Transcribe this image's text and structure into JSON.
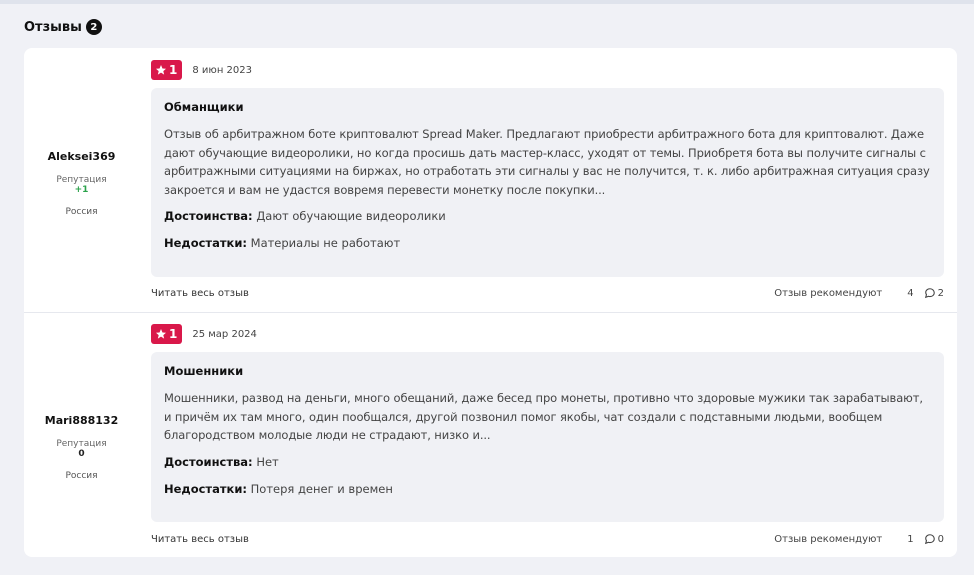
{
  "section": {
    "title": "Отзывы",
    "count": "2"
  },
  "reviews": [
    {
      "author": "Aleksei369",
      "reputation_label": "Репутация",
      "reputation_value": "+1",
      "country": "Россия",
      "rating": "1",
      "date": "8 июн 2023",
      "title": "Обманщики",
      "text": "Отзыв об арбитражном боте криптовалют Spread Maker. Предлагают приобрести арбитражного бота для криптовалют. Даже дают обучающие видеоролики, но когда просишь дать мастер-класс, уходят от темы. Приобретя бота вы получите сигналы с арбитражными ситуациями на биржах, но отработать эти сигналы у вас не получится, т. к. либо арбитражная ситуация сразу закроется и вам не удастся вовремя перевести монетку после покупки...",
      "pros_label": "Достоинства:",
      "pros": "Дают обучающие видеоролики",
      "cons_label": "Недостатки:",
      "cons": "Материалы не работают",
      "read_more": "Читать весь отзыв",
      "recommend_label": "Отзыв рекомендуют",
      "recommend_count": "4",
      "comments_count": "2"
    },
    {
      "author": "Mari888132",
      "reputation_label": "Репутация",
      "reputation_value": "0",
      "country": "Россия",
      "rating": "1",
      "date": "25 мар 2024",
      "title": "Мошенники",
      "text": "Мошенники, развод на деньги, много обещаний, даже бесед про монеты, противно что здоровые мужики так зарабатывают, и причём их там много, один пообщался, другой позвонил помог якобы, чат создали с подставными людьми, вообщем благородством молодые люди не страдают, низко и...",
      "pros_label": "Достоинства:",
      "pros": "Нет",
      "cons_label": "Недостатки:",
      "cons": "Потеря денег и времен",
      "read_more": "Читать весь отзыв",
      "recommend_label": "Отзыв рекомендуют",
      "recommend_count": "1",
      "comments_count": "0"
    }
  ],
  "colors": {
    "rating_badge": "#d9184a",
    "positive_reputation": "#2aa24a",
    "page_background": "#f0f1f6"
  },
  "icons": {
    "rating": "star-icon",
    "comments": "comment-bubble-icon"
  }
}
